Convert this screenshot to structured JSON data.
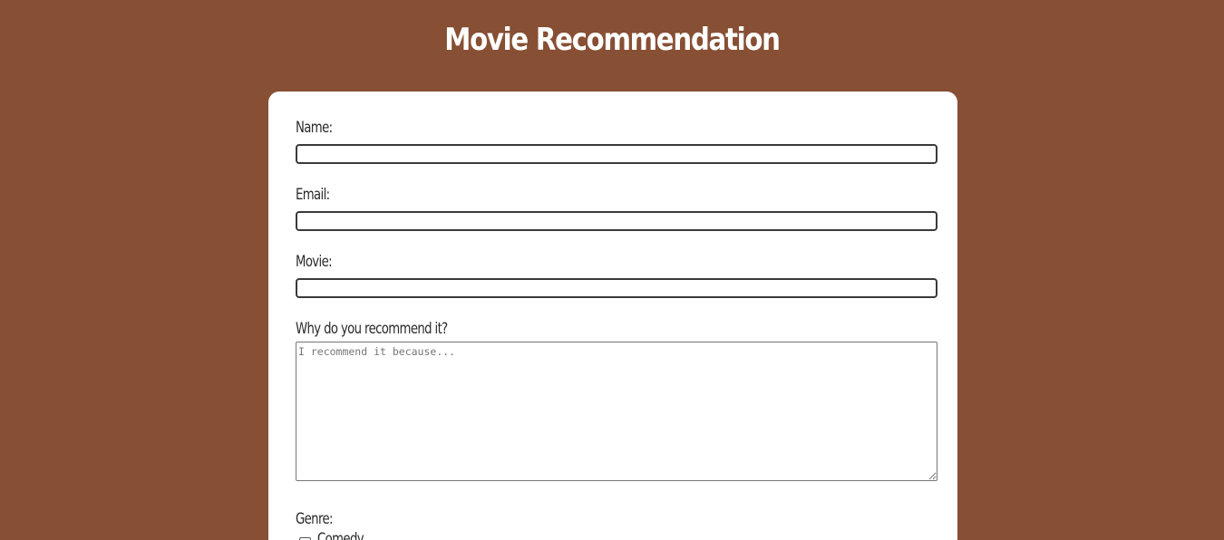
{
  "page": {
    "title": "Movie Recommendation"
  },
  "form": {
    "name": {
      "label": "Name:",
      "value": ""
    },
    "email": {
      "label": "Email:",
      "value": ""
    },
    "movie": {
      "label": "Movie:",
      "value": ""
    },
    "reason": {
      "label": "Why do you recommend it?",
      "value": "",
      "placeholder": "I recommend it because..."
    },
    "genre": {
      "label": "Genre:",
      "options": [
        {
          "label": "Comedy",
          "checked": false
        }
      ]
    }
  },
  "colors": {
    "background": "#874f34",
    "card": "#ffffff",
    "title": "#ffffff"
  }
}
